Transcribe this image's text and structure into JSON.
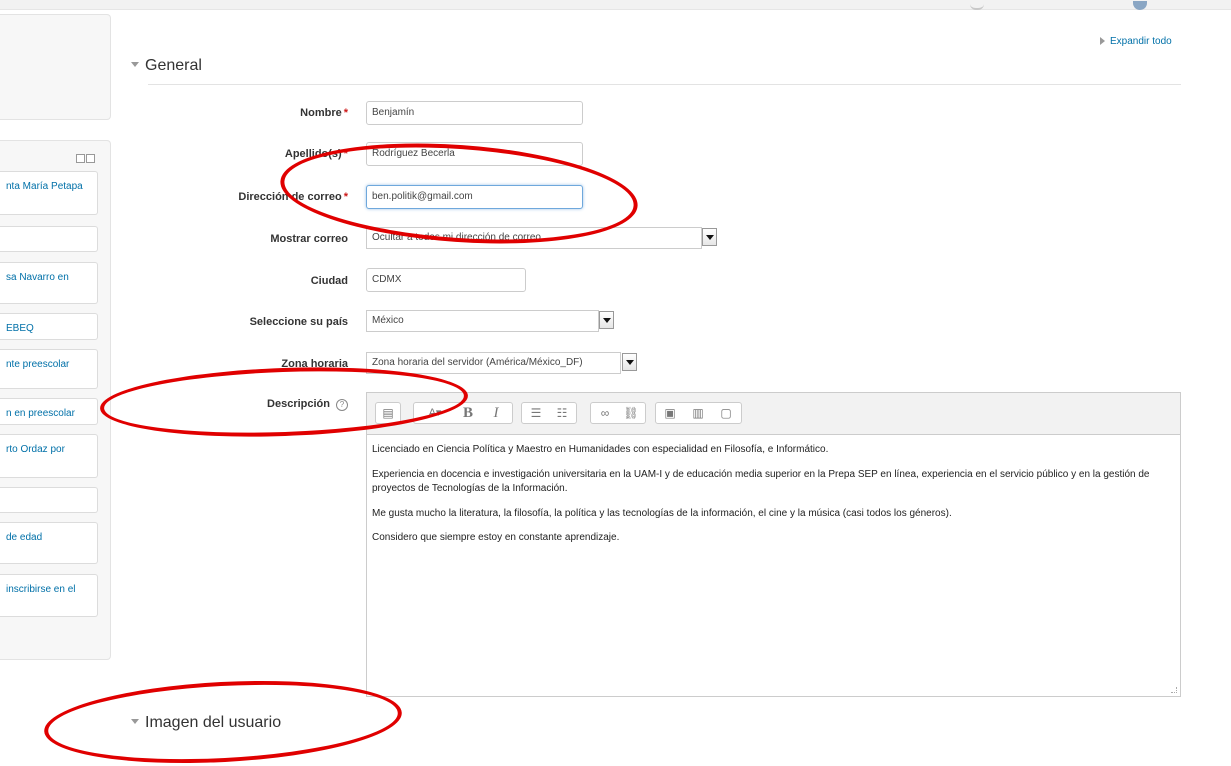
{
  "sidebar": {
    "items": [
      "nta María Petapa",
      "",
      "sa Navarro en",
      "EBEQ",
      "nte preescolar",
      "n en preescolar",
      "rto Ordaz por",
      "",
      "de edad",
      "inscribirse en el"
    ]
  },
  "expand_all": "Expandir todo",
  "sections": {
    "general": "General",
    "imagen": "Imagen del usuario"
  },
  "fields": {
    "nombre": {
      "label": "Nombre",
      "value": "Benjamín"
    },
    "apellidos": {
      "label": "Apellido(s)",
      "value": "Rodríguez Becerla"
    },
    "correo": {
      "label": "Dirección de correo",
      "value": "ben.politik@gmail.com"
    },
    "mostrar_correo": {
      "label": "Mostrar correo",
      "value": "Ocultar a todos mi dirección de correo"
    },
    "ciudad": {
      "label": "Ciudad",
      "value": "CDMX"
    },
    "pais": {
      "label": "Seleccione su país",
      "value": "México"
    },
    "zona": {
      "label": "Zona horaria",
      "value": "Zona horaria del servidor (América/México_DF)"
    },
    "descripcion": {
      "label": "Descripción"
    }
  },
  "required_mark": "*",
  "help_icon": "?",
  "editor": {
    "toolbar_icons": [
      "collapse-icon",
      "font-size-icon",
      "bold-icon",
      "italic-icon",
      "unordered-list-icon",
      "ordered-list-icon",
      "link-icon",
      "unlink-icon",
      "image-icon",
      "media-icon",
      "manage-files-icon"
    ],
    "paragraphs": [
      "Licenciado en Ciencia Política y Maestro en Humanidades con especialidad en Filosofía, e Informático.",
      "Experiencia en docencia e investigación universitaria en la UAM-I y de educación media superior en la Prepa SEP en línea, experiencia en el servicio público y en la gestión de proyectos de Tecnologías de la Información.",
      "Me gusta mucho la literatura, la filosofía, la política y las tecnologías de la información, el cine y la música (casi todos los géneros).",
      "Considero que siempre estoy en constante aprendizaje."
    ]
  },
  "colors": {
    "annotation": "#e00000",
    "link": "#0070a8",
    "required": "#cc1818"
  }
}
